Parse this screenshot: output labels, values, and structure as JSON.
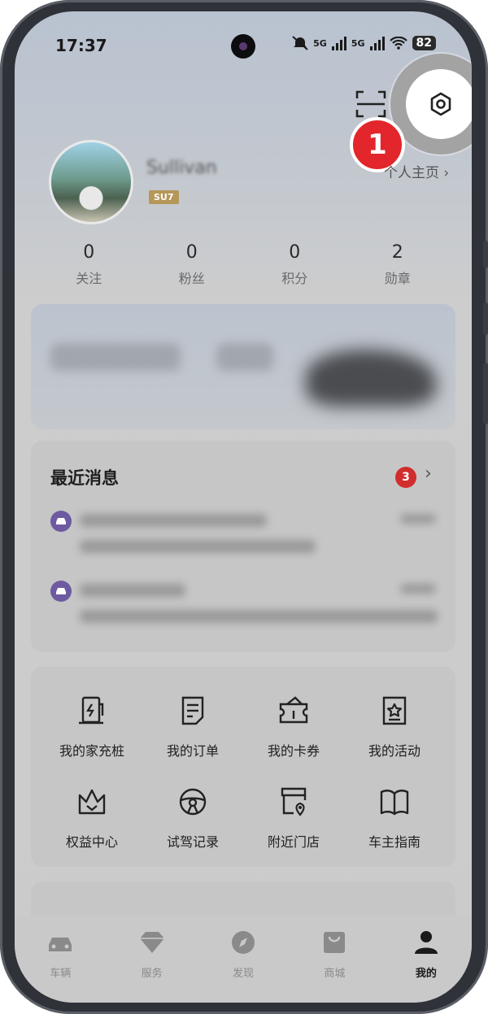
{
  "status_bar": {
    "time": "17:37",
    "network_1": "5G",
    "network_2": "5G",
    "battery": "82"
  },
  "header": {
    "homepage_link": "个人主页 ›",
    "step_number": "1"
  },
  "profile": {
    "username": "Sullivan",
    "level_badge": "SU7"
  },
  "stats": [
    {
      "value": "0",
      "label": "关注"
    },
    {
      "value": "0",
      "label": "粉丝"
    },
    {
      "value": "0",
      "label": "积分"
    },
    {
      "value": "2",
      "label": "勋章"
    }
  ],
  "messages": {
    "title": "最近消息",
    "unread_count": "3"
  },
  "services": [
    {
      "label": "我的家充桩",
      "icon": "charger-icon"
    },
    {
      "label": "我的订单",
      "icon": "order-icon"
    },
    {
      "label": "我的卡券",
      "icon": "ticket-icon"
    },
    {
      "label": "我的活动",
      "icon": "activity-icon"
    },
    {
      "label": "权益中心",
      "icon": "crown-icon"
    },
    {
      "label": "试驾记录",
      "icon": "steering-wheel-icon"
    },
    {
      "label": "附近门店",
      "icon": "store-location-icon"
    },
    {
      "label": "车主指南",
      "icon": "book-icon"
    }
  ],
  "tabs": [
    {
      "label": "车辆",
      "icon": "car-icon"
    },
    {
      "label": "服务",
      "icon": "diamond-icon"
    },
    {
      "label": "发现",
      "icon": "compass-icon"
    },
    {
      "label": "商城",
      "icon": "shopping-bag-icon"
    },
    {
      "label": "我的",
      "icon": "person-icon",
      "active": true
    }
  ],
  "colors": {
    "step_badge": "#e2262b",
    "level_badge": "#b59758",
    "message_badge": "#d22d2d",
    "message_icon": "#6e5aa0"
  }
}
